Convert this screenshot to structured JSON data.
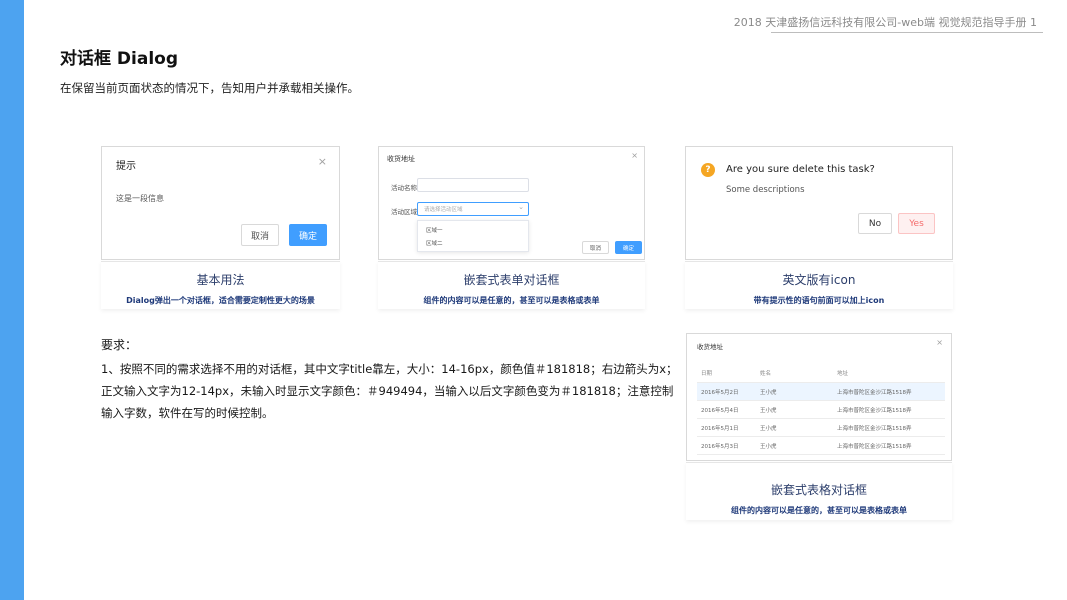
{
  "header": {
    "text": "2018 天津盛扬信远科技有限公司-web端  视觉规范指导手册   1"
  },
  "page": {
    "title": "对话框 Dialog",
    "intro": "在保留当前页面状态的情况下，告知用户并承载相关操作。"
  },
  "examples": [
    {
      "dialog": {
        "title": "提示",
        "message": "这是一段信息",
        "cancel": "取消",
        "confirm": "确定",
        "close": "×"
      },
      "caption": {
        "title": "基本用法",
        "desc": "Dialog弹出一个对话框，适合需要定制性更大的场景"
      }
    },
    {
      "dialog": {
        "title": "收货地址",
        "close": "×",
        "field1_label": "活动名称",
        "field2_label": "活动区域",
        "field2_placeholder": "请选择活动区域",
        "options": [
          "区域一",
          "区域二"
        ],
        "cancel": "取消",
        "confirm": "确定"
      },
      "caption": {
        "title": "嵌套式表单对话框",
        "desc": "组件的内容可以是任意的，甚至可以是表格或表单"
      }
    },
    {
      "dialog": {
        "title": "Are you sure delete this task?",
        "message": "Some descriptions",
        "no": "No",
        "yes": "Yes",
        "icon": "question-icon"
      },
      "caption": {
        "title": "英文版有icon",
        "desc": "带有提示性的语句前面可以加上icon"
      }
    },
    {
      "dialog": {
        "title": "收货地址",
        "close": "×",
        "columns": [
          "日期",
          "姓名",
          "地址"
        ],
        "rows": [
          [
            "2016年5月2日",
            "王小虎",
            "上海市普陀区金沙江路1518弄"
          ],
          [
            "2016年5月4日",
            "王小虎",
            "上海市普陀区金沙江路1518弄"
          ],
          [
            "2016年5月1日",
            "王小虎",
            "上海市普陀区金沙江路1518弄"
          ],
          [
            "2016年5月3日",
            "王小虎",
            "上海市普陀区金沙江路1518弄"
          ]
        ]
      },
      "caption": {
        "title": "嵌套式表格对话框",
        "desc": "组件的内容可以是任意的，甚至可以是表格或表单"
      }
    }
  ],
  "requirements": {
    "heading": "要求：",
    "lines": [
      "1、按照不同的需求选择不用的对话框，其中文字title靠左，大小：14-16px，颜色值＃181818；右边箭头为x；",
      "正文输入文字为12-14px，未输入时显示文字颜色：＃949494，当输入以后文字颜色变为＃181818；注意控制",
      "输入字数，软件在写的时候控制。"
    ]
  },
  "colors": {
    "sidebar": "#4da3f0",
    "primary": "#409eff",
    "warning": "#f5a623",
    "danger": "#f56c6c"
  }
}
